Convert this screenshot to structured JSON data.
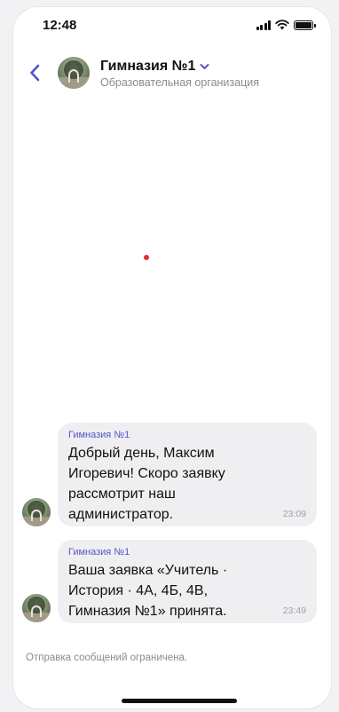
{
  "status_bar": {
    "time": "12:48",
    "icons": [
      "cellular-signal-icon",
      "wifi-icon",
      "battery-icon"
    ]
  },
  "header": {
    "back_icon": "chevron-left-icon",
    "title": "Гимназия №1",
    "title_chevron_icon": "chevron-down-icon",
    "subtitle": "Образовательная организация"
  },
  "messages": [
    {
      "sender": "Гимназия №1",
      "text": "Добрый день, Максим Игоревич! Скоро заявку рассмотрит наш администратор.",
      "time": "23:09"
    },
    {
      "sender": "Гимназия №1",
      "text": "Ваша заявка «Учитель · История · 4А, 4Б, 4В, Гимназия №1» принята.",
      "time": "23:49"
    }
  ],
  "composer": {
    "restricted_text": "Отправка сообщений ограничена."
  },
  "colors": {
    "accent": "#5753c9",
    "bubble": "#efeff2",
    "secondary_text": "#8a8a93",
    "marker": "#e0302b"
  }
}
